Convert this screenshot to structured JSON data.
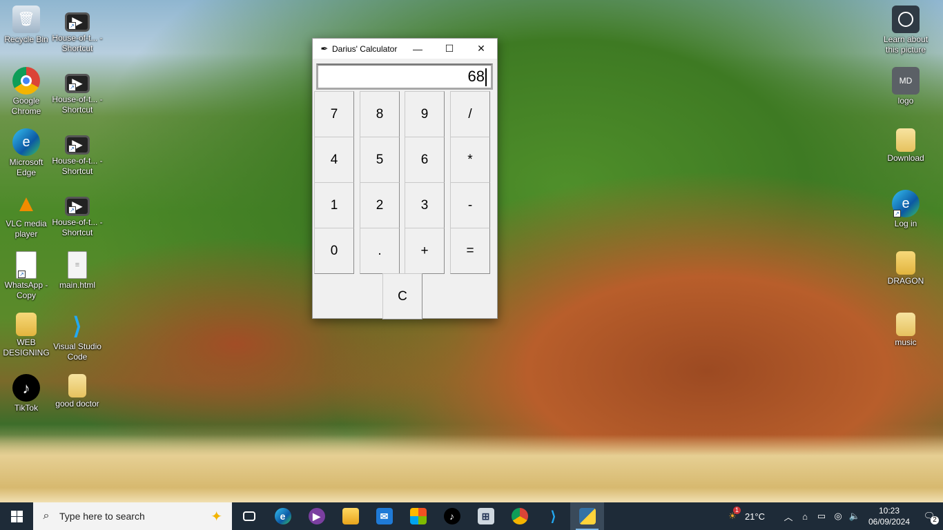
{
  "desktop": {
    "left_icons": [
      {
        "label": "Recycle Bin",
        "icon": "recycle-bin-icon"
      },
      {
        "label": "House-of-t... - Shortcut",
        "icon": "video-file-icon"
      },
      {
        "label": "Google Chrome",
        "icon": "chrome-icon"
      },
      {
        "label": "House-of-t... - Shortcut",
        "icon": "video-file-icon"
      },
      {
        "label": "Microsoft Edge",
        "icon": "edge-icon"
      },
      {
        "label": "House-of-t... - Shortcut",
        "icon": "video-file-icon"
      },
      {
        "label": "VLC media player",
        "icon": "vlc-icon"
      },
      {
        "label": "House-of-t... - Shortcut",
        "icon": "video-file-icon"
      },
      {
        "label": "WhatsApp - Copy",
        "icon": "file-icon"
      },
      {
        "label": "main.html",
        "icon": "file-icon"
      },
      {
        "label": "WEB DESIGNING",
        "icon": "folder-icon"
      },
      {
        "label": "Visual Studio Code",
        "icon": "vscode-icon"
      },
      {
        "label": "TikTok",
        "icon": "tiktok-icon"
      },
      {
        "label": "good doctor",
        "icon": "folder-icon"
      }
    ],
    "right_icons": [
      {
        "label": "Learn about this picture",
        "icon": "camera-icon"
      },
      {
        "label": "logo",
        "icon": "image-file-icon"
      },
      {
        "label": "Download",
        "icon": "folder-icon"
      },
      {
        "label": "Log in",
        "icon": "edge-icon"
      },
      {
        "label": "DRAGON",
        "icon": "folder-icon"
      },
      {
        "label": "music",
        "icon": "folder-icon"
      }
    ]
  },
  "calculator": {
    "title": "Darius' Calculator",
    "display_value": "68",
    "keys": [
      "7",
      "8",
      "9",
      "/",
      "4",
      "5",
      "6",
      "*",
      "1",
      "2",
      "3",
      "-",
      "0",
      ".",
      "+",
      "="
    ],
    "clear_label": "C"
  },
  "taskbar": {
    "search_placeholder": "Type here to search",
    "apps": [
      "task-view-icon",
      "edge-icon",
      "media-player-icon",
      "file-explorer-icon",
      "mail-icon",
      "store-icon",
      "tiktok-icon",
      "remote-desktop-icon",
      "chrome-icon",
      "vscode-icon",
      "python-icon"
    ],
    "weather": "21°C",
    "weather_badge": "1",
    "time": "10:23",
    "date": "06/09/2024",
    "notification_count": "2"
  }
}
